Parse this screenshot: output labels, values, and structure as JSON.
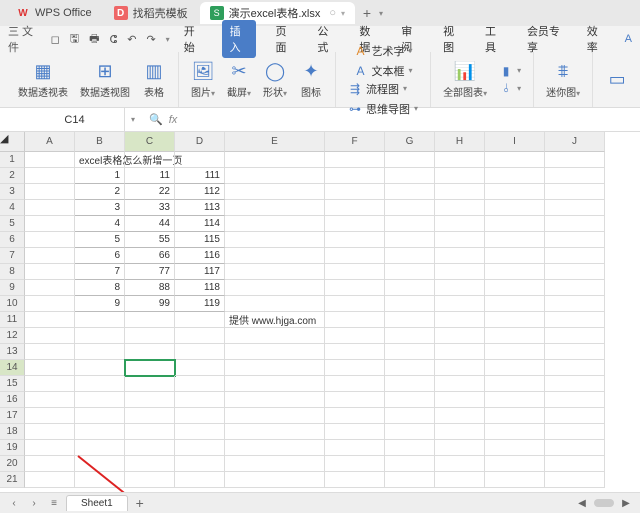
{
  "top_tabs": {
    "app_name": "WPS Office",
    "template_tab": "找稻壳模板",
    "file_tab": "演示excel表格.xlsx",
    "add": "+"
  },
  "qat": {
    "file_menu": "三 文件"
  },
  "menu": {
    "tabs": [
      "开始",
      "插入",
      "页面",
      "公式",
      "数据",
      "审阅",
      "视图",
      "工具",
      "会员专享",
      "效率"
    ],
    "active_index": 1
  },
  "ribbon": {
    "pivot_table": "数据透视表",
    "pivot_chart": "数据透视图",
    "table": "表格",
    "picture": "图片",
    "screenshot": "截屏",
    "shapes": "形状",
    "icons": "图标",
    "wordart": "艺术字",
    "textbox": "文本框",
    "flowchart": "流程图",
    "mindmap": "思维导图",
    "all_charts": "全部图表",
    "sparkline": "迷你图"
  },
  "formula_bar": {
    "name_box": "C14",
    "fx": "fx",
    "value": ""
  },
  "grid": {
    "cols": [
      "A",
      "B",
      "C",
      "D",
      "E",
      "F",
      "G",
      "H",
      "I",
      "J"
    ],
    "active_cell": "C14",
    "title": "excel表格怎么新增一页",
    "data_rows": [
      {
        "b": "1",
        "c": "11",
        "d": "111"
      },
      {
        "b": "2",
        "c": "22",
        "d": "112"
      },
      {
        "b": "3",
        "c": "33",
        "d": "113"
      },
      {
        "b": "4",
        "c": "44",
        "d": "114"
      },
      {
        "b": "5",
        "c": "55",
        "d": "115"
      },
      {
        "b": "6",
        "c": "66",
        "d": "116"
      },
      {
        "b": "7",
        "c": "77",
        "d": "117"
      },
      {
        "b": "8",
        "c": "88",
        "d": "118"
      },
      {
        "b": "9",
        "c": "99",
        "d": "119"
      }
    ],
    "watermark": "提供 www.hjga.com"
  },
  "sheet_bar": {
    "sheet_name": "Sheet1",
    "add": "+"
  }
}
